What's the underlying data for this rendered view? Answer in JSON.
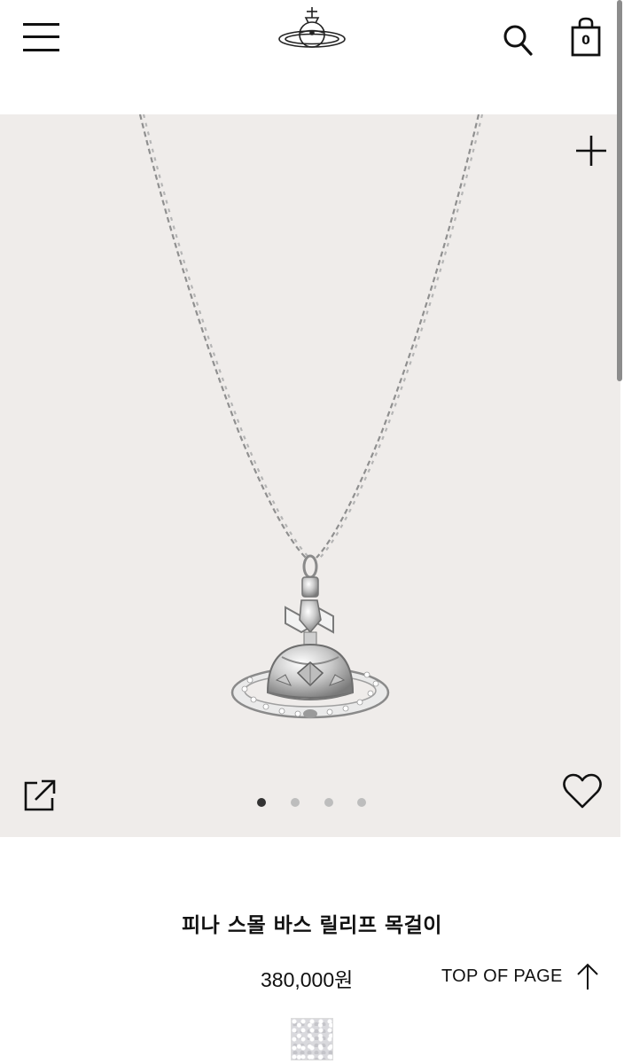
{
  "header": {
    "menu_icon": "hamburger-menu-icon",
    "logo_icon": "orb-logo-icon",
    "search_icon": "search-icon",
    "bag_icon": "shopping-bag-icon",
    "bag_count": "0"
  },
  "gallery": {
    "zoom_icon": "plus-icon",
    "share_icon": "share-icon",
    "wishlist_icon": "heart-icon",
    "image_count": 4,
    "active_index": 0,
    "background_color": "#efecea"
  },
  "product": {
    "title": "피나 스몰 바스 릴리프 목걸이",
    "price": "380,000원"
  },
  "top_link": {
    "label": "TOP OF PAGE",
    "icon": "arrow-up-icon"
  },
  "swatch": {
    "icon": "color-swatch"
  }
}
